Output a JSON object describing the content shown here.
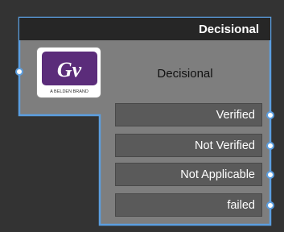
{
  "node": {
    "title": "Decisional",
    "label": "Decisional",
    "logo": {
      "brand_text": "A BELDEN BRAND",
      "icon": "grass-valley-logo-icon"
    },
    "input_port": {
      "icon": "input-port-icon"
    },
    "outputs": [
      {
        "label": "Verified"
      },
      {
        "label": "Not Verified"
      },
      {
        "label": "Not Applicable"
      },
      {
        "label": "failed"
      }
    ]
  },
  "colors": {
    "background": "#333333",
    "node_body": "#7e7e7e",
    "title_bar": "#262626",
    "outline_accent": "#5b9ee0",
    "port_button": "#5a5a5a",
    "logo_purple": "#5b2c7a"
  }
}
